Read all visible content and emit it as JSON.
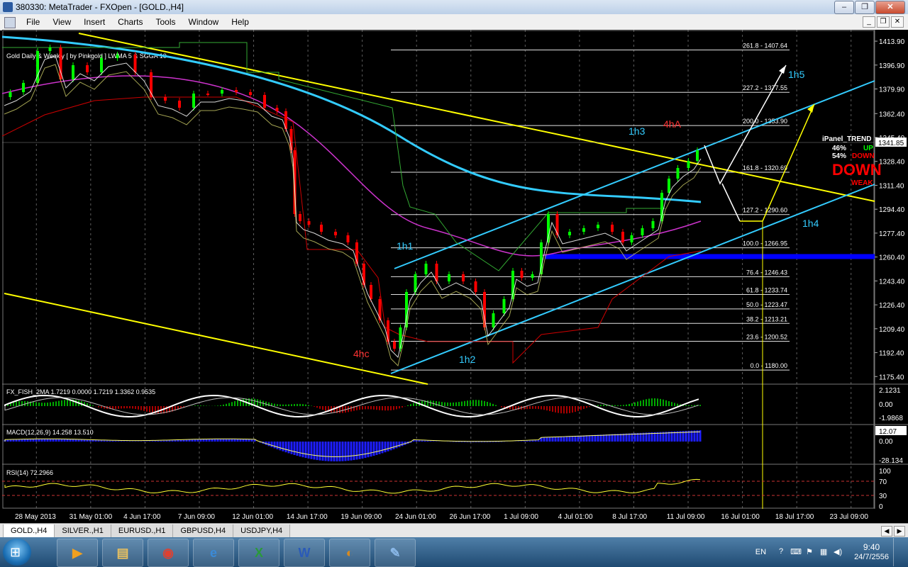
{
  "window": {
    "title": "380330: MetaTrader - FXOpen - [GOLD.,H4]",
    "minimize": "–",
    "maximize": "❐",
    "close": "✕"
  },
  "menu": [
    "File",
    "View",
    "Insert",
    "Charts",
    "Tools",
    "Window",
    "Help"
  ],
  "chart": {
    "header": "Gold Daily & Weekly [ by Pinkgold ] LWMA 5 & SGGA 10",
    "current_price": "1341.85",
    "panel": {
      "title": "iPanel_TREND",
      "up_pct": "46%",
      "up_label": "UP",
      "down_pct": "54%",
      "down_label": "DOWN",
      "big": "DOWN",
      "strength": "WEAK"
    },
    "price_axis": [
      "1413.90",
      "1396.90",
      "1379.90",
      "1362.40",
      "1345.40",
      "1328.40",
      "1311.40",
      "1294.40",
      "1277.40",
      "1260.40",
      "1243.40",
      "1226.40",
      "1209.40",
      "1192.40",
      "1175.40"
    ],
    "fib_levels": [
      {
        "label": "261.8 - 1407.64",
        "price": 1407.64
      },
      {
        "label": "227.2 - 1377.55",
        "price": 1377.55
      },
      {
        "label": "200.0 - 1353.90",
        "price": 1353.9
      },
      {
        "label": "161.8 - 1320.69",
        "price": 1320.69
      },
      {
        "label": "127.2 - 1290.60",
        "price": 1290.6
      },
      {
        "label": "100.0 - 1266.95",
        "price": 1266.95
      },
      {
        "label": "76.4 - 1246.43",
        "price": 1246.43
      },
      {
        "label": "61.8 - 1233.74",
        "price": 1233.74
      },
      {
        "label": "50.0 - 1223.47",
        "price": 1223.47
      },
      {
        "label": "38.2 - 1213.21",
        "price": 1213.21
      },
      {
        "label": "23.6 - 1200.52",
        "price": 1200.52
      },
      {
        "label": "0.0 - 1180.00",
        "price": 1180.0
      }
    ],
    "wave_labels": {
      "h1": "1h1",
      "h2": "1h2",
      "h3": "1h3",
      "h4": "1h4",
      "h5": "1h5",
      "hc": "4hc",
      "ha": "4hA"
    },
    "time_axis": [
      "28 May 2013",
      "31 May 01:00",
      "4 Jun 17:00",
      "7 Jun 09:00",
      "12 Jun 01:00",
      "14 Jun 17:00",
      "19 Jun 09:00",
      "24 Jun 01:00",
      "26 Jun 17:00",
      "1 Jul 09:00",
      "4 Jul 01:00",
      "8 Jul 17:00",
      "11 Jul 09:00",
      "16 Jul 01:00",
      "18 Jul 17:00",
      "23 Jul 09:00"
    ],
    "fisher": {
      "label": "FX_FISH_2MA 1.7219 0.0000 1.7219 1.3362 0.9535",
      "axis": [
        "2.1231",
        "0.00",
        "-1.9868"
      ]
    },
    "macd": {
      "label": "MACD(12,26,9) 14.258 13.510",
      "current": "12.07",
      "axis": [
        "0.00",
        "-28.134"
      ]
    },
    "rsi": {
      "label": "RSI(14) 72.2966",
      "axis": [
        "100",
        "70",
        "30",
        "0"
      ]
    },
    "colors": {
      "up": "#00ff00",
      "down": "#ff0000",
      "cyan": "#33ccff",
      "yellow": "#ffff00",
      "blue_zone": "#0000ff",
      "magenta": "#cc33cc"
    }
  },
  "tabs": [
    "GOLD.,H4",
    "SILVER.,H1",
    "EURUSD.,H1",
    "GBPUSD,H4",
    "USDJPY,H4"
  ],
  "taskbar": {
    "apps": [
      {
        "name": "media-player-icon",
        "glyph": "▶"
      },
      {
        "name": "explorer-icon",
        "glyph": "▤"
      },
      {
        "name": "chrome-icon",
        "glyph": "◉"
      },
      {
        "name": "internet-explorer-icon",
        "glyph": "e"
      },
      {
        "name": "excel-icon",
        "glyph": "X"
      },
      {
        "name": "word-icon",
        "glyph": "W"
      },
      {
        "name": "metatrader-icon",
        "glyph": "◐"
      },
      {
        "name": "paint-icon",
        "glyph": "✎"
      }
    ],
    "lang": "EN",
    "time": "9:40",
    "date": "24/7/2556"
  }
}
